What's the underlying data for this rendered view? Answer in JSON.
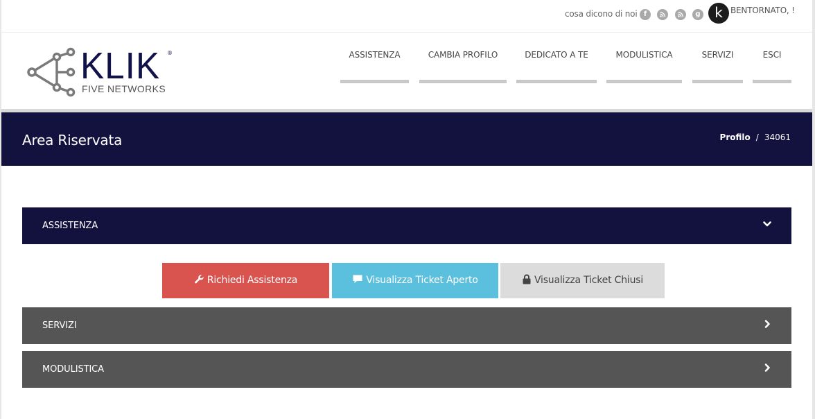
{
  "topbar": {
    "testimonials_link": "cosa dicono di noi",
    "social_icons": [
      "facebook-icon",
      "rss-icon",
      "rss-icon",
      "google-plus-icon"
    ],
    "avatar_letter": "k",
    "welcome": "BENTORNATO, !"
  },
  "logo": {
    "word": "KLIK",
    "registered": "®",
    "sub": "FIVE NETWORKS",
    "color": "#12124a"
  },
  "nav": {
    "items": [
      {
        "label": "ASSISTENZA"
      },
      {
        "label": "CAMBIA PROFILO"
      },
      {
        "label": "DEDICATO A TE"
      },
      {
        "label": "MODULISTICA"
      },
      {
        "label": "SERVIZI"
      },
      {
        "label": "ESCI"
      }
    ]
  },
  "banner": {
    "title": "Area Riservata",
    "breadcrumb": [
      "Profilo",
      "/",
      "34061"
    ],
    "color": "#13123f"
  },
  "accordion": {
    "sections": [
      {
        "label": "ASSISTENZA",
        "state": "expanded",
        "icon": "chevron-down-icon"
      },
      {
        "label": "SERVIZI",
        "state": "collapsed",
        "icon": "chevron-right-icon"
      },
      {
        "label": "MODULISTICA",
        "state": "collapsed",
        "icon": "chevron-right-icon"
      }
    ]
  },
  "actions": {
    "request": {
      "label": "Richiedi Assistenza",
      "icon": "wrench-icon",
      "color": "#d9534f"
    },
    "open_tickets": {
      "label": "Visualizza Ticket Aperto",
      "icon": "comment-icon",
      "color": "#5bc0de"
    },
    "closed_tickets": {
      "label": "Visualizza Ticket Chiusi",
      "icon": "lock-icon",
      "color": "#dcdcdc"
    }
  }
}
